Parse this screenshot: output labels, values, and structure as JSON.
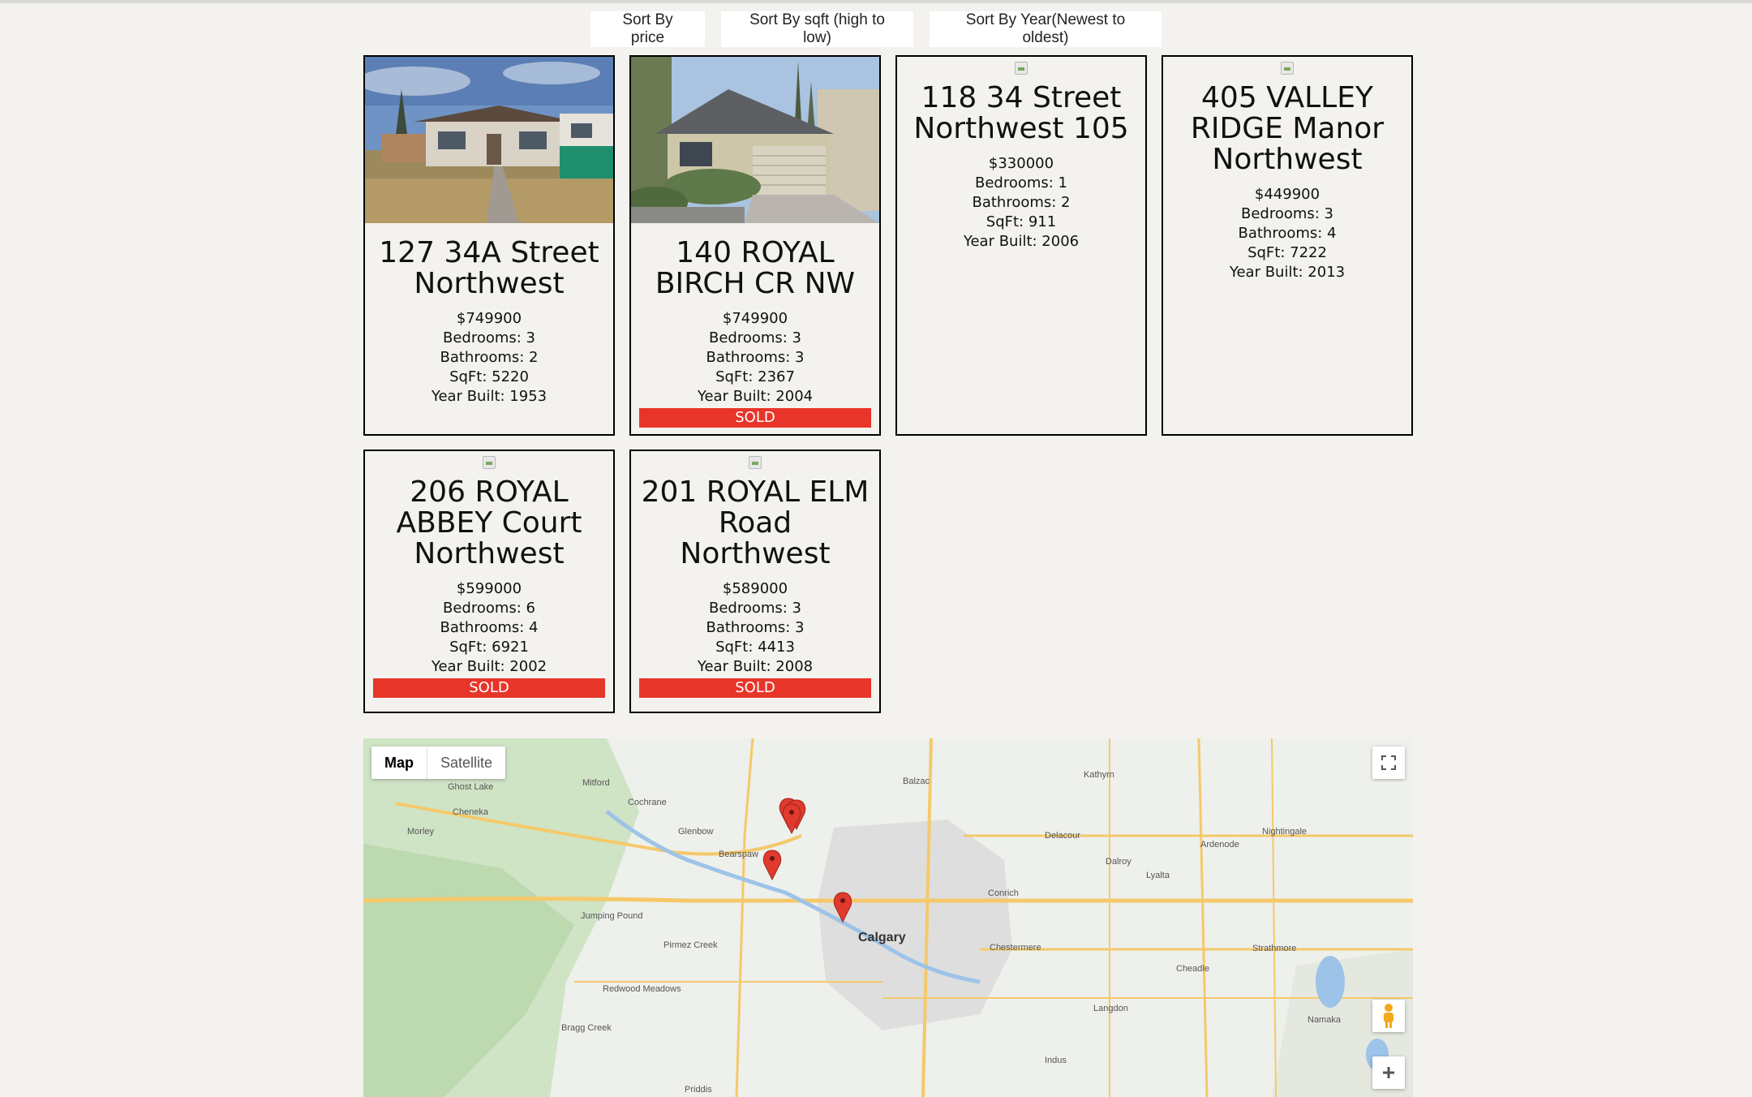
{
  "sort_buttons": {
    "price": "Sort By price",
    "sqft": "Sort By sqft (high to low)",
    "year": "Sort By Year(Newest to oldest)"
  },
  "listings": [
    {
      "address": "127 34A Street Northwest",
      "price": "$749900",
      "bedrooms": "Bedrooms: 3",
      "bathrooms": "Bathrooms: 2",
      "sqft": "SqFt: 5220",
      "year": "Year Built: 1953"
    },
    {
      "address": "140 ROYAL BIRCH CR NW",
      "price": "$749900",
      "bedrooms": "Bedrooms: 3",
      "bathrooms": "Bathrooms: 3",
      "sqft": "SqFt: 2367",
      "year": "Year Built: 2004",
      "status": "SOLD"
    },
    {
      "address": "118 34 Street Northwest 105",
      "price": "$330000",
      "bedrooms": "Bedrooms: 1",
      "bathrooms": "Bathrooms: 2",
      "sqft": "SqFt: 911",
      "year": "Year Built: 2006"
    },
    {
      "address": "405 VALLEY RIDGE Manor Northwest",
      "price": "$449900",
      "bedrooms": "Bedrooms: 3",
      "bathrooms": "Bathrooms: 4",
      "sqft": "SqFt: 7222",
      "year": "Year Built: 2013"
    },
    {
      "address": "206 ROYAL ABBEY Court Northwest",
      "price": "$599000",
      "bedrooms": "Bedrooms: 6",
      "bathrooms": "Bathrooms: 4",
      "sqft": "SqFt: 6921",
      "year": "Year Built: 2002",
      "status": "SOLD"
    },
    {
      "address": "201 ROYAL ELM Road Northwest",
      "price": "$589000",
      "bedrooms": "Bedrooms: 3",
      "bathrooms": "Bathrooms: 3",
      "sqft": "SqFt: 4413",
      "year": "Year Built: 2008",
      "status": "SOLD"
    }
  ],
  "map": {
    "type_map": "Map",
    "type_satellite": "Satellite",
    "icons": [
      "fullscreen-icon",
      "pegman-icon",
      "zoom-in-icon",
      "map-marker-icon"
    ],
    "places": {
      "calgary": "Calgary",
      "mitford": "Mitford",
      "cochrane": "Cochrane",
      "balzac": "Balzac",
      "kathyrn": "Kathyrn",
      "ghost_lake": "Ghost Lake",
      "cheneka": "Cheneka",
      "morley": "Morley",
      "glenbow": "Glenbow",
      "bearspaw": "Bearspaw",
      "delacour": "Delacour",
      "nightingale": "Nightingale",
      "ardenode": "Ardenode",
      "dalroy": "Dalroy",
      "lyalta": "Lyalta",
      "conrich": "Conrich",
      "jumping_pound": "Jumping Pound",
      "pirmez_creek": "Pirmez Creek",
      "chestermere": "Chestermere",
      "strathmore": "Strathmore",
      "cheadle": "Cheadle",
      "redwood_meadows": "Redwood Meadows",
      "langdon": "Langdon",
      "namaka": "Namaka",
      "bragg_creek": "Bragg Creek",
      "indus": "Indus",
      "priddis": "Priddis"
    }
  }
}
